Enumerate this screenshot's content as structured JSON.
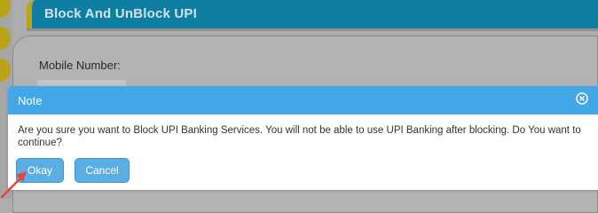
{
  "page": {
    "title": "Block And UnBlock UPI",
    "mobile_label": "Mobile Number:"
  },
  "dialog": {
    "title": "Note",
    "message": "Are you sure you want to Block UPI Banking Services. You will not be able to use UPI Banking after blocking. Do You want to continue?",
    "okay_label": "Okay",
    "cancel_label": "Cancel"
  },
  "icons": {
    "close": "close-icon",
    "annotation": "red-arrow-icon"
  },
  "colors": {
    "header": "#0e7ea2",
    "dialog_header": "#42a7e6",
    "button": "#5aaee3",
    "arrow": "#e8453c",
    "accent_tab": "#b9a418"
  }
}
